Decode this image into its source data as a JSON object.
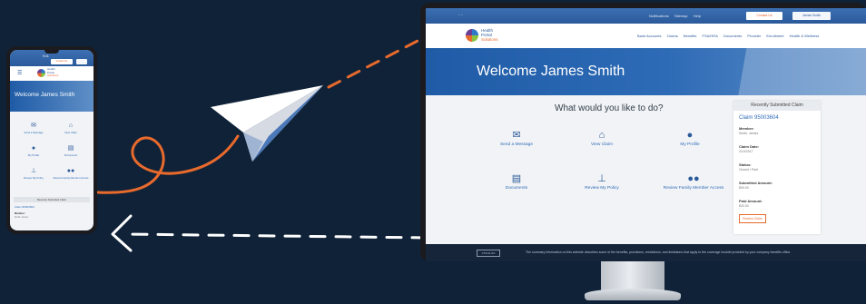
{
  "desktop": {
    "topbar": {
      "links": [
        "Notifications",
        "Sitemap",
        "Help"
      ],
      "contact_label": "Contact Us",
      "user_label": "James Smith"
    },
    "logo": {
      "line1": "Health",
      "line2": "Portal",
      "line3": "Solutions"
    },
    "nav": [
      "Bank Accounts",
      "Claims",
      "Benefits",
      "FSA/HRA",
      "Documents",
      "Provider",
      "Enrollment",
      "Health & Wellness"
    ],
    "welcome": "Welcome James Smith",
    "question": "What would you like to do?",
    "tiles": [
      {
        "icon": "envelope-icon",
        "label": "Send a Message"
      },
      {
        "icon": "inbox-icon",
        "label": "View Claim"
      },
      {
        "icon": "user-icon",
        "label": "My Profile"
      },
      {
        "icon": "document-icon",
        "label": "Documents"
      },
      {
        "icon": "pin-icon",
        "label": "Review My Policy"
      },
      {
        "icon": "family-icon",
        "label": "Review Family Member Access"
      }
    ],
    "recent": {
      "title": "Recently Submitted Claim",
      "claim": "Claim 95003604",
      "fields": [
        {
          "label": "Member:",
          "value": "Smith, James"
        },
        {
          "label": "Claim Date:",
          "value": "2/10/2017"
        },
        {
          "label": "Status:",
          "value": "Closed / Paid"
        },
        {
          "label": "Submitted Amount:",
          "value": "$90.00"
        },
        {
          "label": "Paid Amount:",
          "value": "$20.00"
        }
      ],
      "view_label": "Review Claim"
    },
    "footer": {
      "badge": "CTR ALSO",
      "disclaimer": "The summary information on this website describes some of the benefits, provisions, restrictions, and limitations that apply to the coverage booklet provided by your company benefits office."
    }
  },
  "mobile": {
    "time": "9:41",
    "contact_label": "Contact Us",
    "logo": {
      "line1": "Health",
      "line2": "Portal",
      "line3": "Solutions"
    },
    "welcome": "Welcome James Smith",
    "tiles": [
      {
        "icon": "envelope-icon",
        "label": "Send a Message"
      },
      {
        "icon": "inbox-icon",
        "label": "View Claim"
      },
      {
        "icon": "user-icon",
        "label": "My Profile"
      },
      {
        "icon": "document-icon",
        "label": "Documents"
      },
      {
        "icon": "pin-icon",
        "label": "Review My Policy"
      },
      {
        "icon": "family-icon",
        "label": "Review Family Member Access"
      }
    ],
    "recent_title": "Recently Submitted Claim",
    "claim": "Claim 95003604",
    "member_label": "Member:",
    "member_value": "Smith, James"
  },
  "colors": {
    "background": "#0f2238",
    "brand_blue": "#2b5a9a",
    "accent_orange": "#e86a2c",
    "dash_white": "#ffffff"
  }
}
